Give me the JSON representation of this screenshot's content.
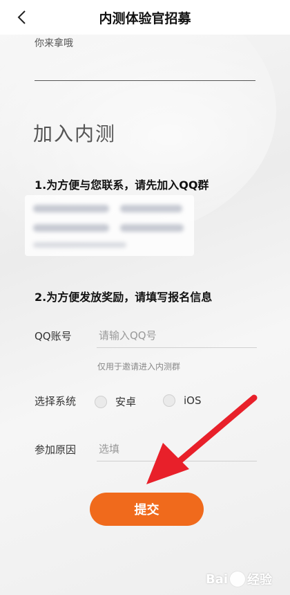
{
  "header": {
    "title": "内测体验官招募"
  },
  "form": {
    "prev_field_text": "你来拿哦",
    "section_title": "加入内测",
    "step1_text": "1.为方便与您联系，请先加入QQ群",
    "step2_text": "2.为方便发放奖励，请填写报名信息",
    "qq_label": "QQ账号",
    "qq_placeholder": "请输入QQ号",
    "qq_hint": "仅用于邀请进入内测群",
    "system_label": "选择系统",
    "system_options": [
      "安卓",
      "iOS"
    ],
    "reason_label": "参加原因",
    "reason_placeholder": "选填",
    "submit_label": "提交"
  },
  "watermark": {
    "text_left": "Bai",
    "text_right": "经验"
  },
  "colors": {
    "accent": "#f06a1c",
    "arrow": "#e8202a"
  }
}
